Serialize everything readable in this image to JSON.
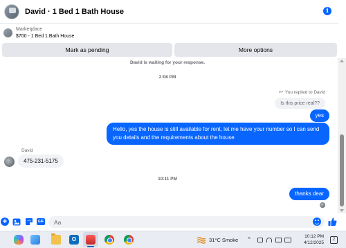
{
  "header": {
    "title": "David · 1 Bed 1 Bath House"
  },
  "listing": {
    "source": "Marketplace",
    "price_title": "$700 - 1 Bed 1 Bath House"
  },
  "actions": {
    "pending_label": "Mark as pending",
    "more_label": "More options"
  },
  "chat": {
    "waiting_notice": "David is waiting for your response.",
    "time_1": "2:08 PM",
    "replied_label": "You replied to David",
    "quoted_text": "Is this price real??",
    "messages": [
      {
        "from": "me",
        "text": "yes"
      },
      {
        "from": "me",
        "text": "Hello, yes the house is still available for rent, let me have your number so I can send you details and the requirements about the house"
      },
      {
        "from": "David",
        "text": "475-231-5175"
      },
      {
        "from": "me",
        "text": "thanks dear"
      }
    ],
    "sender_name": "David",
    "time_2": "10:11 PM"
  },
  "composer": {
    "placeholder": "Aa",
    "gif_label": "GIF"
  },
  "taskbar": {
    "weather": "31°C  Smoke",
    "time": "10:12 PM",
    "date": "4/12/2025",
    "notification_count": "2",
    "outlook_letter": "O"
  },
  "colors": {
    "accent": "#0866ff",
    "bubble_in": "#f0f2f5",
    "button_bg": "#e4e6eb",
    "taskbar_bg": "#e9edf3"
  },
  "icons": [
    "info-icon",
    "reply-icon",
    "plus-icon",
    "image-icon",
    "sticker-icon",
    "gif-icon",
    "emoji-icon",
    "like-icon",
    "weather-icon",
    "bell-icon"
  ]
}
